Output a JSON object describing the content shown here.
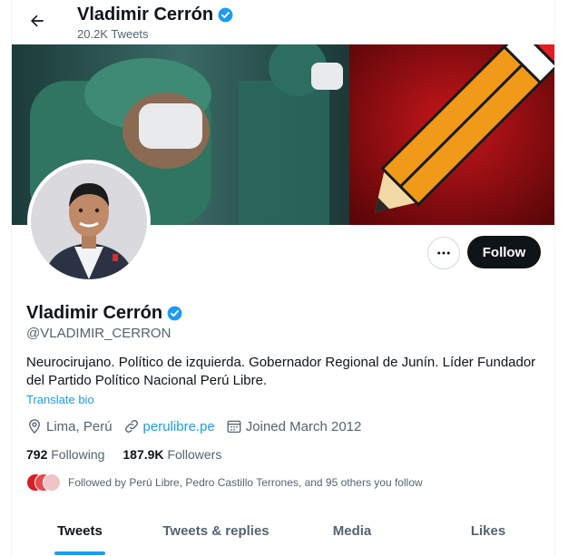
{
  "header": {
    "name": "Vladimir Cerrón",
    "tweet_count": "20.2K Tweets"
  },
  "profile": {
    "name": "Vladimir Cerrón",
    "handle": "@VLADIMIR_CERRON",
    "bio": "Neurocirujano. Político de izquierda. Gobernador Regional de Junín. Líder Fundador del Partido Político Nacional Perú Libre.",
    "translate_label": "Translate bio",
    "location": "Lima, Perú",
    "website": "perulibre.pe",
    "joined": "Joined March 2012",
    "following_count": "792",
    "following_label": "Following",
    "followers_count": "187.9K",
    "followers_label": "Followers",
    "followed_by": "Followed by Perú Libre, Pedro Castillo Terrones, and 95 others you follow"
  },
  "actions": {
    "follow_label": "Follow",
    "more_icon": "more-icon"
  },
  "tabs": [
    {
      "label": "Tweets",
      "active": true
    },
    {
      "label": "Tweets & replies",
      "active": false
    },
    {
      "label": "Media",
      "active": false
    },
    {
      "label": "Likes",
      "active": false
    }
  ],
  "colors": {
    "accent": "#1d9bf0",
    "follow_bg": "#0f1419",
    "secondary_text": "#536471",
    "banner_left": "#1f4f4a",
    "banner_right": "#8c0f12"
  }
}
